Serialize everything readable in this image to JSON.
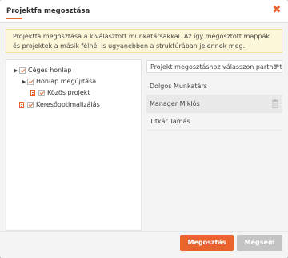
{
  "dialog": {
    "title": "Projektfa megosztása",
    "info_text": "Projektfa megosztása a kiválasztott munkatársakkal. Az így megosztott mappák és projektek a másik félnél is ugyanebben a struktúrában jelennek meg."
  },
  "tree": [
    {
      "label": "Céges honlap"
    },
    {
      "label": "Honlap megújítása"
    },
    {
      "label": "Közös projekt"
    },
    {
      "label": "Keresőoptimalizálás"
    }
  ],
  "partner_select": {
    "placeholder": "Projekt megosztáshoz válasszon partnert"
  },
  "partners": [
    {
      "name": "Dolgos Munkatárs"
    },
    {
      "name": "Manager Miklós"
    },
    {
      "name": "Titkár Tamás"
    }
  ],
  "buttons": {
    "share": "Megosztás",
    "cancel": "Mégsem"
  },
  "colors": {
    "accent": "#e8632e",
    "info_bg": "#fdf7d9"
  },
  "icons": [
    "close-icon",
    "caret-right-icon",
    "checkbox-checked-icon",
    "document-icon",
    "trash-icon",
    "chevron-down-icon"
  ]
}
